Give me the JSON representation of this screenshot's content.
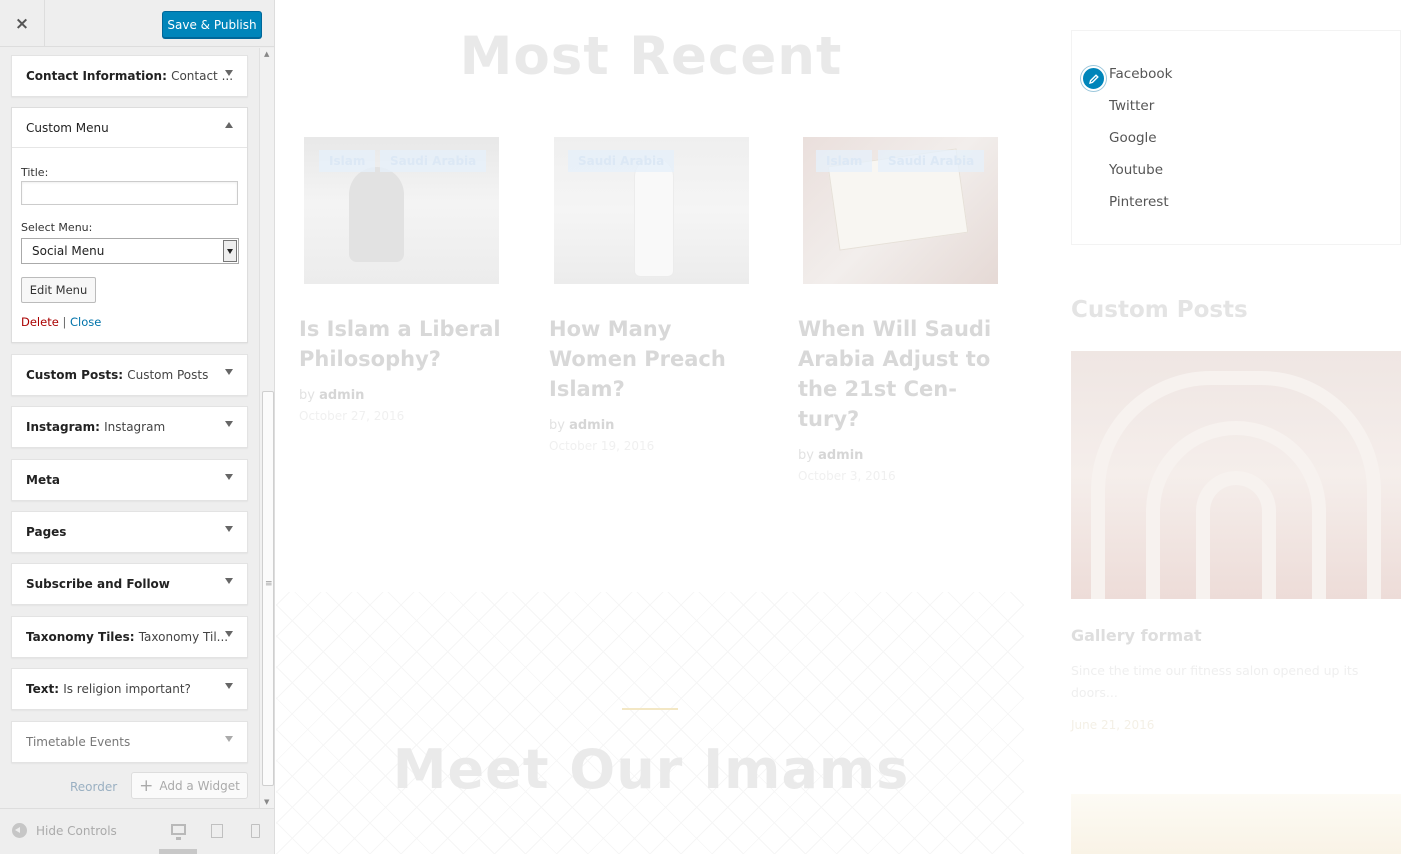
{
  "customizer": {
    "close_icon": "×",
    "save_label": "Save & Publish",
    "widgets": [
      {
        "title": "Contact Information:",
        "subtitle": "Contact ..."
      },
      {
        "title": "Custom Menu",
        "expanded": true
      },
      {
        "title": "Custom Posts:",
        "subtitle": "Custom Posts"
      },
      {
        "title": "Instagram:",
        "subtitle": "Instagram"
      },
      {
        "title": "Meta",
        "subtitle": ""
      },
      {
        "title": "Pages",
        "subtitle": ""
      },
      {
        "title": "Subscribe and Follow",
        "subtitle": ""
      },
      {
        "title": "Taxonomy Tiles:",
        "subtitle": "Taxonomy Til..."
      },
      {
        "title": "Text:",
        "subtitle": "Is religion important?"
      },
      {
        "title": "Timetable Events",
        "subtitle": ""
      }
    ],
    "custom_menu_form": {
      "title_label": "Title:",
      "title_value": "",
      "select_label": "Select Menu:",
      "select_value": "Social Menu",
      "edit_button": "Edit Menu",
      "delete_link": "Delete",
      "separator": "|",
      "close_link": "Close"
    },
    "reorder_label": "Reorder",
    "add_widget_label": "Add a Widget",
    "hide_controls_label": "Hide Controls",
    "accent_color": "#0085ba"
  },
  "preview": {
    "section_title": "Most Recent",
    "posts": [
      {
        "tags": [
          "Islam",
          "Saudi Arabia"
        ],
        "title": "Is Islam a Liberal Philosophy?",
        "by": "by",
        "author": "admin",
        "date": "October 27, 2016"
      },
      {
        "tags": [
          "Saudi Arabia"
        ],
        "title": "How Many Women Preach Islam?",
        "by": "by",
        "author": "admin",
        "date": "October 19, 2016"
      },
      {
        "tags": [
          "Islam",
          "Saudi Arabia"
        ],
        "title": "When Will Saudi Arabia Adjust to the 21st Cen- tury?",
        "by": "by",
        "author": "admin",
        "date": "October 3, 2016"
      }
    ],
    "imams_title": "Meet Our Imams",
    "social_menu": [
      "Facebook",
      "Twitter",
      "Google",
      "Youtube",
      "Pinterest"
    ],
    "custom_posts_title": "Custom Posts",
    "custom_post": {
      "title": "Gallery format",
      "excerpt": "Since the time our fitness salon opened up its doors...",
      "date": "June 21, 2016"
    }
  }
}
